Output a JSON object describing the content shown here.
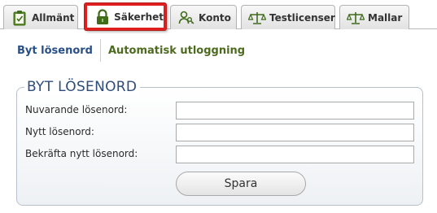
{
  "tabs": [
    {
      "label": "Allmänt",
      "icon": "clipboard-icon"
    },
    {
      "label": "Säkerhet",
      "icon": "lock-icon",
      "active": true
    },
    {
      "label": "Konto",
      "icon": "user-key-icon"
    },
    {
      "label": "Testlicenser",
      "icon": "scale-icon"
    },
    {
      "label": "Mallar",
      "icon": "scale-icon"
    }
  ],
  "subnav": {
    "change_password": "Byt lösenord",
    "auto_logout": "Automatisk utloggning"
  },
  "form": {
    "legend": "BYT LÖSENORD",
    "current_label": "Nuvarande lösenord:",
    "current_value": "",
    "new_label": "Nytt lösenord:",
    "new_value": "",
    "confirm_label": "Bekräfta nytt lösenord:",
    "confirm_value": "",
    "save_label": "Spara"
  },
  "colors": {
    "active_tab_highlight": "#e01e1e",
    "icon_green": "#3f6b1b",
    "link_blue": "#2a4f86",
    "link_green": "#4d6a1f"
  }
}
